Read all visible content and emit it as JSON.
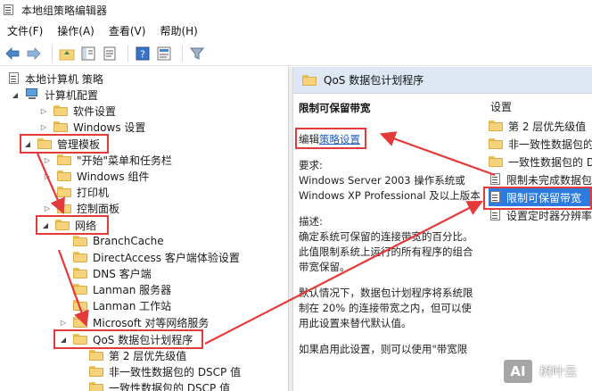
{
  "window": {
    "title": "本地组策略编辑器"
  },
  "menu": [
    "文件(F)",
    "操作(A)",
    "查看(V)",
    "帮助(H)"
  ],
  "tree": {
    "root": "本地计算机 策略",
    "computer_config": "计算机配置",
    "items": [
      {
        "label": "软件设置"
      },
      {
        "label": "Windows 设置"
      },
      {
        "label": "管理模板"
      },
      {
        "label": "\"开始\"菜单和任务栏"
      },
      {
        "label": "Windows 组件"
      },
      {
        "label": "打印机"
      },
      {
        "label": "控制面板"
      },
      {
        "label": "网络"
      },
      {
        "label": "BranchCache"
      },
      {
        "label": "DirectAccess 客户端体验设置"
      },
      {
        "label": "DNS 客户端"
      },
      {
        "label": "Lanman 服务器"
      },
      {
        "label": "Lanman 工作站"
      },
      {
        "label": "Microsoft 对等网络服务"
      },
      {
        "label": "QoS 数据包计划程序"
      },
      {
        "label": "第 2 层优先级值"
      },
      {
        "label": "非一致性数据包的 DSCP 值"
      },
      {
        "label": "一致性数据包的 DSCP 值"
      }
    ]
  },
  "right": {
    "header_title": "QoS 数据包计划程序",
    "policy_title": "限制可保留带宽",
    "edit_prefix": "编辑",
    "edit_link": "策略设置",
    "requirements_label": "要求:",
    "requirements_text": "Windows Server 2003 操作系统或 Windows XP Professional 及以上版本",
    "description_label": "描述:",
    "description_p1": "确定系统可保留的连接带宽的百分比。此值限制系统上运行的所有程序的组合带宽保留。",
    "description_p2": "默认情况下，数据包计划程序将系统限制在 20% 的连接带宽之内，但可以使用此设置来替代默认值。",
    "description_p3": "如果启用此设置，则可以使用\"带宽限"
  },
  "settings_list": {
    "header": "设置",
    "items": [
      {
        "label": "第 2 层优先级值",
        "kind": "folder"
      },
      {
        "label": "非一致性数据包的",
        "kind": "folder"
      },
      {
        "label": "一致性数据包的 D",
        "kind": "folder"
      },
      {
        "label": "限制未完成数据包",
        "kind": "policy"
      },
      {
        "label": "限制可保留带宽",
        "kind": "policy",
        "selected": true
      },
      {
        "label": "设置定时器分辨率",
        "kind": "policy"
      }
    ]
  },
  "watermark": {
    "logo": "AI",
    "text": "树叶云"
  },
  "colors": {
    "highlight": "#e43a3a",
    "selection": "#2c7be0",
    "link": "#1f5fbf",
    "header_bg": "#dde8f4"
  }
}
